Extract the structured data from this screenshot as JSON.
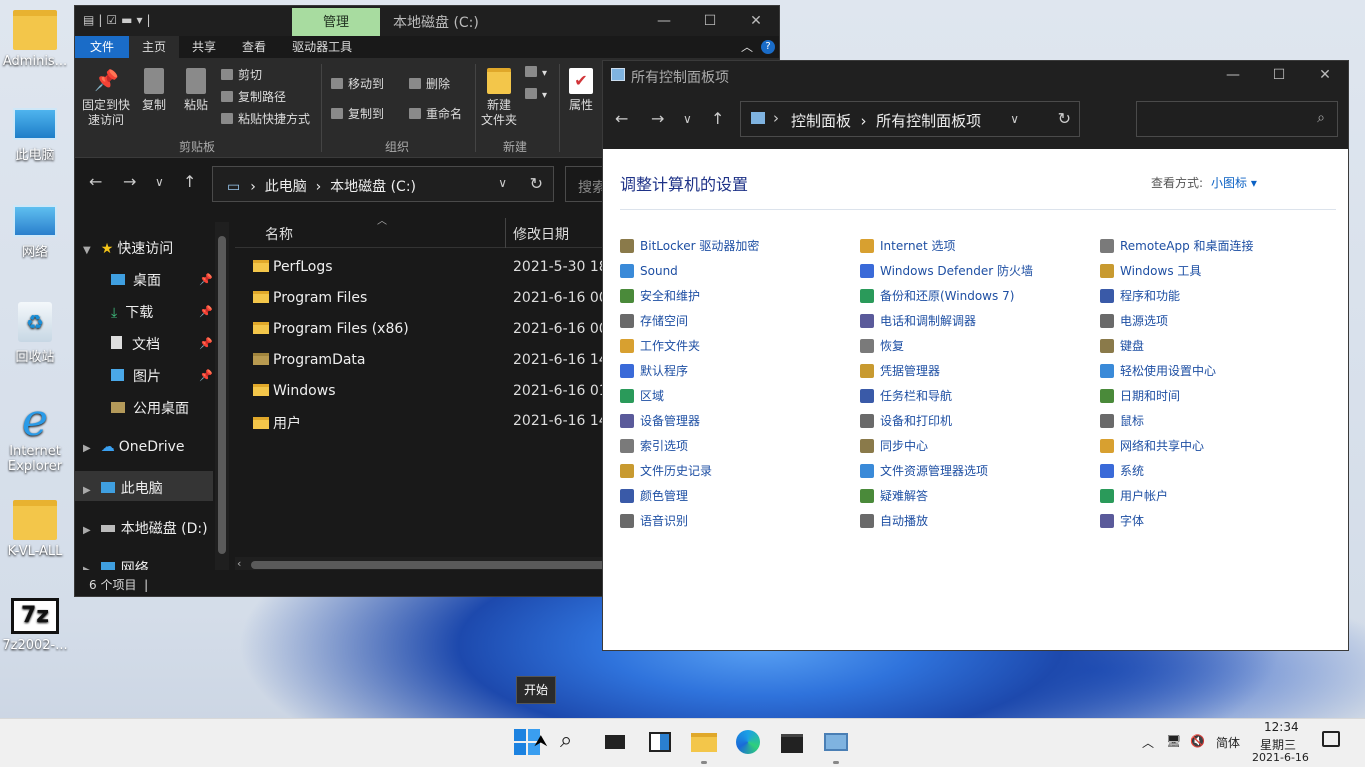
{
  "desktop": {
    "icons": [
      {
        "label": "Adminis..."
      },
      {
        "label": "此电脑"
      },
      {
        "label": "网络"
      },
      {
        "label": "回收站"
      },
      {
        "label": "Internet Explorer"
      },
      {
        "label": "K-VL-ALL"
      },
      {
        "label": "7z2002-..."
      }
    ]
  },
  "explorer": {
    "context_tab": "管理",
    "title": "本地磁盘 (C:)",
    "window_buttons": {
      "minimize": "—",
      "maximize": "☐",
      "close": "✕"
    },
    "ribbon_tabs": [
      "文件",
      "主页",
      "共享",
      "查看",
      "驱动器工具"
    ],
    "ribbon": {
      "pin": "固定到快\n速访问",
      "copy": "复制",
      "paste": "粘贴",
      "cut": "剪切",
      "copy_path": "复制路径",
      "paste_shortcut": "粘贴快捷方式",
      "group_clipboard": "剪贴板",
      "move_to": "移动到",
      "copy_to": "复制到",
      "delete": "删除",
      "rename": "重命名",
      "group_organize": "组织",
      "new_folder": "新建\n文件夹",
      "group_new": "新建",
      "properties": "属性"
    },
    "breadcrumb": [
      "此电脑",
      "本地磁盘 (C:)"
    ],
    "search_placeholder": "搜索",
    "nav": {
      "quick_access": "快速访问",
      "items": [
        "桌面",
        "下载",
        "文档",
        "图片",
        "公用桌面"
      ],
      "onedrive": "OneDrive",
      "this_pc": "此电脑",
      "drive_d": "本地磁盘 (D:)",
      "network": "网络"
    },
    "columns": {
      "name": "名称",
      "date": "修改日期"
    },
    "files": [
      {
        "name": "PerfLogs",
        "date": "2021-5-30 18:"
      },
      {
        "name": "Program Files",
        "date": "2021-6-16 00:"
      },
      {
        "name": "Program Files (x86)",
        "date": "2021-6-16 00:"
      },
      {
        "name": "ProgramData",
        "date": "2021-6-16 14:"
      },
      {
        "name": "Windows",
        "date": "2021-6-16 01:"
      },
      {
        "name": "用户",
        "date": "2021-6-16 14:"
      }
    ],
    "status": "6 个项目"
  },
  "control_panel": {
    "title": "所有控制面板项",
    "breadcrumb": [
      "控制面板",
      "所有控制面板项"
    ],
    "heading": "调整计算机的设置",
    "view_by_label": "查看方式:",
    "view_by_value": "小图标 ▾",
    "col1": [
      "BitLocker 驱动器加密",
      "Sound",
      "安全和维护",
      "存储空间",
      "工作文件夹",
      "默认程序",
      "区域",
      "设备管理器",
      "索引选项",
      "文件历史记录",
      "颜色管理",
      "语音识别"
    ],
    "col2": [
      "Internet 选项",
      "Windows Defender 防火墙",
      "备份和还原(Windows 7)",
      "电话和调制解调器",
      "恢复",
      "凭据管理器",
      "任务栏和导航",
      "设备和打印机",
      "同步中心",
      "文件资源管理器选项",
      "疑难解答",
      "自动播放"
    ],
    "col3": [
      "RemoteApp 和桌面连接",
      "Windows 工具",
      "程序和功能",
      "电源选项",
      "键盘",
      "轻松使用设置中心",
      "日期和时间",
      "鼠标",
      "网络和共享中心",
      "系统",
      "用户帐户",
      "字体"
    ]
  },
  "taskbar": {
    "tooltip": "开始",
    "ime": "简体",
    "time": "12:34",
    "weekday": "星期三",
    "date": "2021-6-16"
  }
}
